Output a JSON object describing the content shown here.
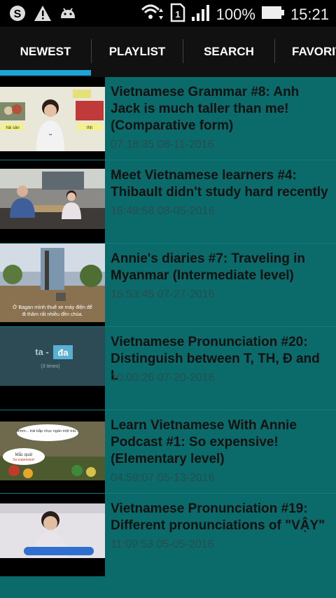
{
  "status": {
    "battery": "100%",
    "time": "15:21",
    "sim": "1",
    "icons": [
      "skype-icon",
      "warning-icon",
      "android-icon",
      "wifi-icon",
      "signal-icon",
      "battery-icon"
    ]
  },
  "tabs": [
    "NEWEST",
    "PLAYLIST",
    "SEARCH",
    "FAVORIT"
  ],
  "videos": [
    {
      "title": "Vietnamese Grammar #8: Anh Jack is much taller than me! (Comparative form)",
      "date": "07:18:35 08-11-2016"
    },
    {
      "title": "Meet Vietnamese learners #4: Thibault didn't study hard recently",
      "date": "16:49:58 08-05-2016"
    },
    {
      "title": "Annie's diaries #7: Traveling in Myanmar (Intermediate level)",
      "date": "15:53:45 07-27-2016"
    },
    {
      "title": "Vietnamese Pronunciation #20: Distinguish between T, TH, Đ and L",
      "date": "10:00:26 07-20-2016"
    },
    {
      "title": "Learn Vietnamese With Annie Podcast #1: So expensive! (Elementary level)",
      "date": "04:59:07 05-13-2016"
    },
    {
      "title": "Vietnamese Pronunciation #19: Different pronunciations of \"VẬY\"",
      "date": "11:09:53 05-05-2016"
    }
  ],
  "thumbs": [
    {
      "text1": "hải sản",
      "text2": "thịt"
    },
    {},
    {
      "caption": "Ở Bagan mình thuê xe máy điện để đi thăm rất nhiều đền chùa."
    },
    {
      "word": "ta - đa",
      "count": "(3 times)"
    },
    {
      "bubble1": "Hmm... trái bắp chục ngàn một trái...",
      "bubble2": "Mắc quá! So expensive!"
    },
    {}
  ],
  "colors": {
    "background": "#0b6a6a",
    "tabbar": "#111111",
    "indicator": "#1da3d6"
  }
}
